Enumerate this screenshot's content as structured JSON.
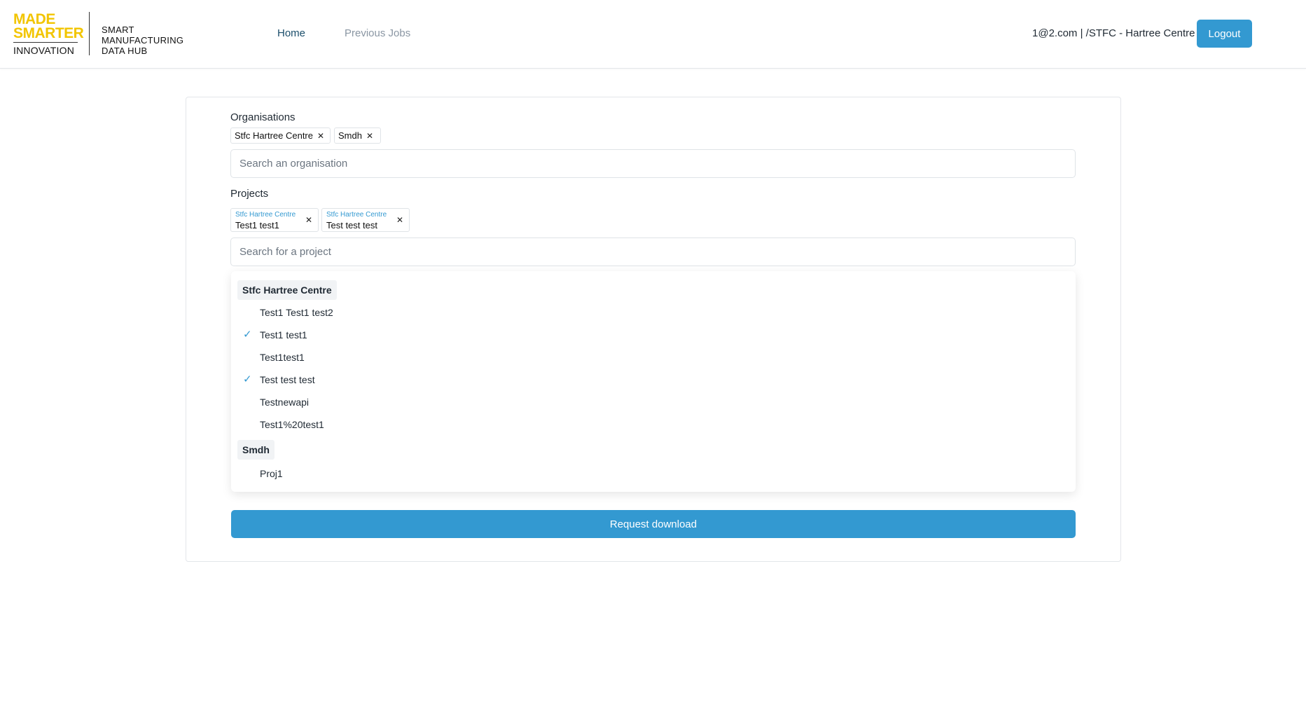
{
  "brand": {
    "made": "MADE",
    "smarter": "SMARTER",
    "innovation": "INNOVATION",
    "hub_line1": "SMART",
    "hub_line2": "MANUFACTURING",
    "hub_line3": "DATA HUB",
    "accent_color": "#f2c500"
  },
  "nav": {
    "home": "Home",
    "previous_jobs": "Previous Jobs"
  },
  "user": {
    "info": "1@2.com | /STFC - Hartree Centre",
    "logout": "Logout"
  },
  "form": {
    "organisations_label": "Organisations",
    "selected_orgs": [
      {
        "name": "Stfc Hartree Centre"
      },
      {
        "name": "Smdh"
      }
    ],
    "org_search_placeholder": "Search an organisation",
    "projects_label": "Projects",
    "selected_projects": [
      {
        "org": "Stfc Hartree Centre",
        "name": "Test1 test1"
      },
      {
        "org": "Stfc Hartree Centre",
        "name": "Test test test"
      }
    ],
    "project_search_placeholder": "Search for a project",
    "remove_glyph": "✕",
    "request_button": "Request download"
  },
  "dropdown": {
    "check_glyph": "✓",
    "groups": [
      {
        "name": "Stfc Hartree Centre",
        "options": [
          {
            "label": "Test1 Test1 test2",
            "selected": false
          },
          {
            "label": "Test1 test1",
            "selected": true
          },
          {
            "label": "Test1test1",
            "selected": false
          },
          {
            "label": "Test test test",
            "selected": true
          },
          {
            "label": "Testnewapi",
            "selected": false
          },
          {
            "label": "Test1%20test1",
            "selected": false
          }
        ]
      },
      {
        "name": "Smdh",
        "options": [
          {
            "label": "Proj1",
            "selected": false
          }
        ]
      }
    ]
  },
  "colors": {
    "primary": "#3399d1",
    "nav_active": "#1b4e6b",
    "nav_inactive": "#8a96a3"
  }
}
